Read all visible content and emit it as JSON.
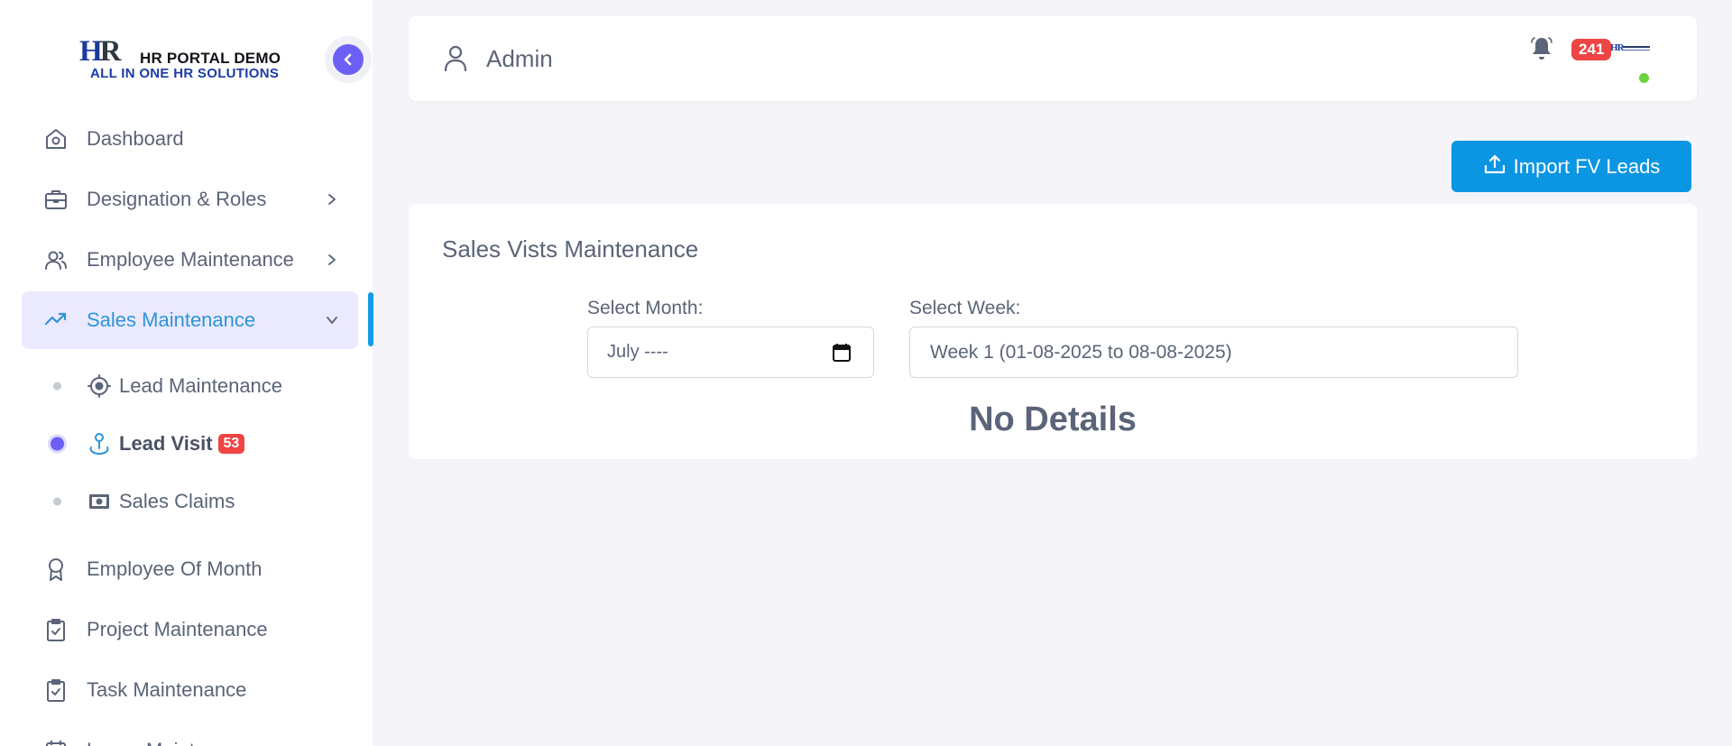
{
  "brand": {
    "mark_h": "H",
    "mark_r": "R",
    "title": "HR PORTAL DEMO",
    "subtitle": "ALL IN ONE HR SOLUTIONS"
  },
  "sidebar": {
    "items": [
      {
        "label": "Dashboard",
        "icon": "home-icon"
      },
      {
        "label": "Designation & Roles",
        "icon": "briefcase-icon"
      },
      {
        "label": "Employee Maintenance",
        "icon": "users-icon"
      },
      {
        "label": "Sales Maintenance",
        "icon": "trending-up-icon"
      },
      {
        "label": "Employee Of Month",
        "icon": "award-icon"
      },
      {
        "label": "Project Maintenance",
        "icon": "clipboard-check-icon"
      },
      {
        "label": "Task Maintenance",
        "icon": "clipboard-check-icon"
      },
      {
        "label": "Leave Maintenance",
        "icon": "calendar-icon"
      }
    ],
    "sub_items": [
      {
        "label": "Lead Maintenance",
        "icon": "crosshair-icon"
      },
      {
        "label": "Lead Visit",
        "icon": "map-pin-icon",
        "badge": "53"
      },
      {
        "label": "Sales Claims",
        "icon": "cash-icon"
      }
    ]
  },
  "header": {
    "user_name": "Admin",
    "notification_count": "241"
  },
  "toolbar": {
    "import_label": "Import FV Leads"
  },
  "main": {
    "title": "Sales Vists Maintenance",
    "month_label": "Select Month:",
    "month_value": "July ----",
    "week_label": "Select Week:",
    "week_value": "Week 1 (01-08-2025 to 08-08-2025)",
    "empty_text": "No Details"
  },
  "colors": {
    "accent": "#6c5ff5",
    "primary_button": "#0b96e3",
    "badge": "#ef4444",
    "active_text": "#2d95d8",
    "online": "#6ad33e"
  }
}
